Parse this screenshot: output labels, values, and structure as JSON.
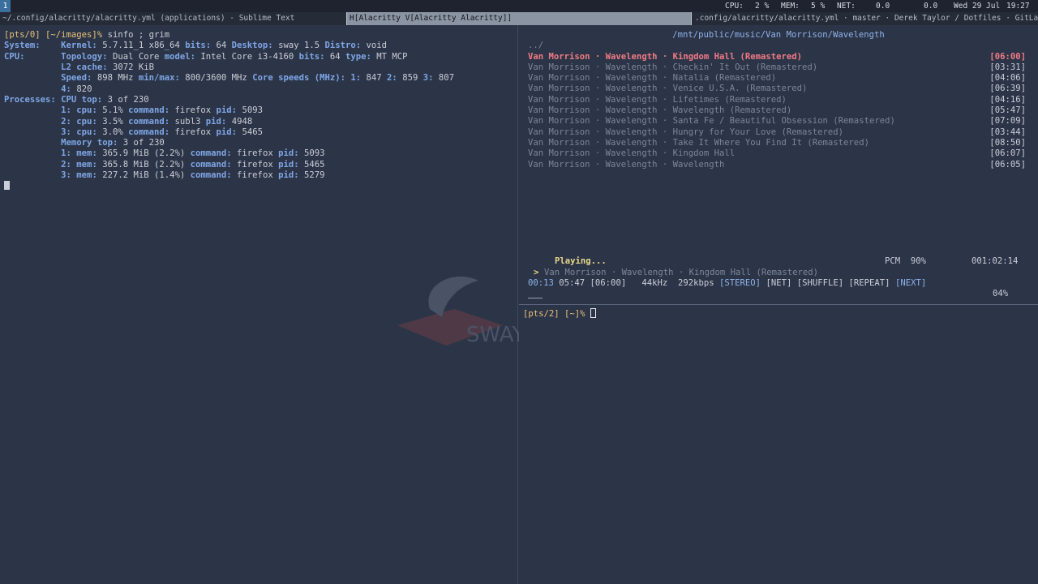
{
  "topbar": {
    "workspace": "1",
    "cpu_label": "CPU:",
    "cpu_value": "2 %",
    "mem_label": "MEM:",
    "mem_value": "5 %",
    "net_label": "NET:",
    "net_down": "0.0",
    "net_up": "0.0",
    "date": "Wed 29 Jul",
    "time": "19:27"
  },
  "titlebar": {
    "tab1": "~/.config/alacritty/alacritty.yml (applications) - Sublime Text",
    "tab2": "H[Alacritty V[Alacritty Alacritty]]",
    "tab3": ".config/alacritty/alacritty.yml · master · Derek Taylor / Dotfiles · GitLab - M"
  },
  "left_term": {
    "prompt": "[pts/0] [~/images]%",
    "command": " sinfo ; grim",
    "lines": [
      [
        [
          "lbl",
          "System:    Kernel:"
        ],
        [
          "t",
          " 5.7.11_1 x86_64 "
        ],
        [
          "lbl",
          "bits:"
        ],
        [
          "t",
          " 64 "
        ],
        [
          "lbl",
          "Desktop:"
        ],
        [
          "t",
          " sway 1.5 "
        ],
        [
          "lbl",
          "Distro:"
        ],
        [
          "t",
          " void"
        ]
      ],
      [
        [
          "lbl",
          "CPU:       Topology:"
        ],
        [
          "t",
          " Dual Core "
        ],
        [
          "lbl",
          "model:"
        ],
        [
          "t",
          " Intel Core i3-4160 "
        ],
        [
          "lbl",
          "bits:"
        ],
        [
          "t",
          " 64 "
        ],
        [
          "lbl",
          "type:"
        ],
        [
          "t",
          " MT MCP"
        ]
      ],
      [
        [
          "t",
          "           "
        ],
        [
          "lbl",
          "L2 cache:"
        ],
        [
          "t",
          " 3072 KiB"
        ]
      ],
      [
        [
          "t",
          "           "
        ],
        [
          "lbl",
          "Speed:"
        ],
        [
          "t",
          " 898 MHz "
        ],
        [
          "lbl",
          "min/max:"
        ],
        [
          "t",
          " 800/3600 MHz "
        ],
        [
          "lbl",
          "Core speeds (MHz):"
        ],
        [
          "t",
          " "
        ],
        [
          "lbl",
          "1:"
        ],
        [
          "t",
          " 847 "
        ],
        [
          "lbl",
          "2:"
        ],
        [
          "t",
          " 859 "
        ],
        [
          "lbl",
          "3:"
        ],
        [
          "t",
          " 807"
        ]
      ],
      [
        [
          "t",
          "           "
        ],
        [
          "lbl",
          "4:"
        ],
        [
          "t",
          " 820"
        ]
      ],
      [
        [
          "lbl",
          "Processes: CPU top:"
        ],
        [
          "t",
          " 3 of 230"
        ]
      ],
      [
        [
          "t",
          "           "
        ],
        [
          "lbl",
          "1: cpu:"
        ],
        [
          "t",
          " 5.1% "
        ],
        [
          "lbl",
          "command:"
        ],
        [
          "t",
          " firefox "
        ],
        [
          "lbl",
          "pid:"
        ],
        [
          "t",
          " 5093"
        ]
      ],
      [
        [
          "t",
          "           "
        ],
        [
          "lbl",
          "2: cpu:"
        ],
        [
          "t",
          " 3.5% "
        ],
        [
          "lbl",
          "command:"
        ],
        [
          "t",
          " subl3 "
        ],
        [
          "lbl",
          "pid:"
        ],
        [
          "t",
          " 4948"
        ]
      ],
      [
        [
          "t",
          "           "
        ],
        [
          "lbl",
          "3: cpu:"
        ],
        [
          "t",
          " 3.0% "
        ],
        [
          "lbl",
          "command:"
        ],
        [
          "t",
          " firefox "
        ],
        [
          "lbl",
          "pid:"
        ],
        [
          "t",
          " 5465"
        ]
      ],
      [
        [
          "t",
          "           "
        ],
        [
          "lbl",
          "Memory top:"
        ],
        [
          "t",
          " 3 of 230"
        ]
      ],
      [
        [
          "t",
          "           "
        ],
        [
          "lbl",
          "1: mem:"
        ],
        [
          "t",
          " 365.9 MiB (2.2%) "
        ],
        [
          "lbl",
          "command:"
        ],
        [
          "t",
          " firefox "
        ],
        [
          "lbl",
          "pid:"
        ],
        [
          "t",
          " 5093"
        ]
      ],
      [
        [
          "t",
          "           "
        ],
        [
          "lbl",
          "2: mem:"
        ],
        [
          "t",
          " 365.8 MiB (2.2%) "
        ],
        [
          "lbl",
          "command:"
        ],
        [
          "t",
          " firefox "
        ],
        [
          "lbl",
          "pid:"
        ],
        [
          "t",
          " 5465"
        ]
      ],
      [
        [
          "t",
          "           "
        ],
        [
          "lbl",
          "3: mem:"
        ],
        [
          "t",
          " 227.2 MiB (1.4%) "
        ],
        [
          "lbl",
          "command:"
        ],
        [
          "t",
          " firefox "
        ],
        [
          "lbl",
          "pid:"
        ],
        [
          "t",
          " 5279"
        ]
      ]
    ]
  },
  "player": {
    "path": "/mnt/public/music/Van Morrison/Wavelength",
    "parent_dir": "../",
    "songs": [
      {
        "title": "Van Morrison · Wavelength · Kingdom Hall (Remastered)",
        "duration": "[06:00]",
        "active": true
      },
      {
        "title": "Van Morrison · Wavelength · Checkin' It Out (Remastered)",
        "duration": "[03:31]"
      },
      {
        "title": "Van Morrison · Wavelength · Natalia (Remastered)",
        "duration": "[04:06]"
      },
      {
        "title": "Van Morrison · Wavelength · Venice U.S.A. (Remastered)",
        "duration": "[06:39]"
      },
      {
        "title": "Van Morrison · Wavelength · Lifetimes (Remastered)",
        "duration": "[04:16]"
      },
      {
        "title": "Van Morrison · Wavelength · Wavelength (Remastered)",
        "duration": "[05:47]"
      },
      {
        "title": "Van Morrison · Wavelength · Santa Fe / Beautiful Obsession (Remastered)",
        "duration": "[07:09]"
      },
      {
        "title": "Van Morrison · Wavelength · Hungry for Your Love (Remastered)",
        "duration": "[03:44]"
      },
      {
        "title": "Van Morrison · Wavelength · Take It Where You Find It (Remastered)",
        "duration": "[08:50]"
      },
      {
        "title": "Van Morrison · Wavelength · Kingdom Hall",
        "duration": "[06:07]"
      },
      {
        "title": "Van Morrison · Wavelength · Wavelength",
        "duration": "[06:05]"
      }
    ],
    "state": "Playing...",
    "mixer": "PCM  90%",
    "total_time": "001:02:14",
    "now_playing_marker": ">",
    "now_playing": "Van Morrison · Wavelength · Kingdom Hall (Remastered)",
    "elapsed": "00:13",
    "remaining": "05:47 [06:00]",
    "format": "44kHz  292kbps",
    "flags": [
      "[STEREO]",
      "[NET]",
      "[SHUFFLE]",
      "[REPEAT]",
      "[NEXT]"
    ],
    "progress_text": "04%",
    "progress_fraction": 0.04
  },
  "right_term": {
    "prompt": "[pts/2] [~]%"
  },
  "watermark_text": "SWAY"
}
